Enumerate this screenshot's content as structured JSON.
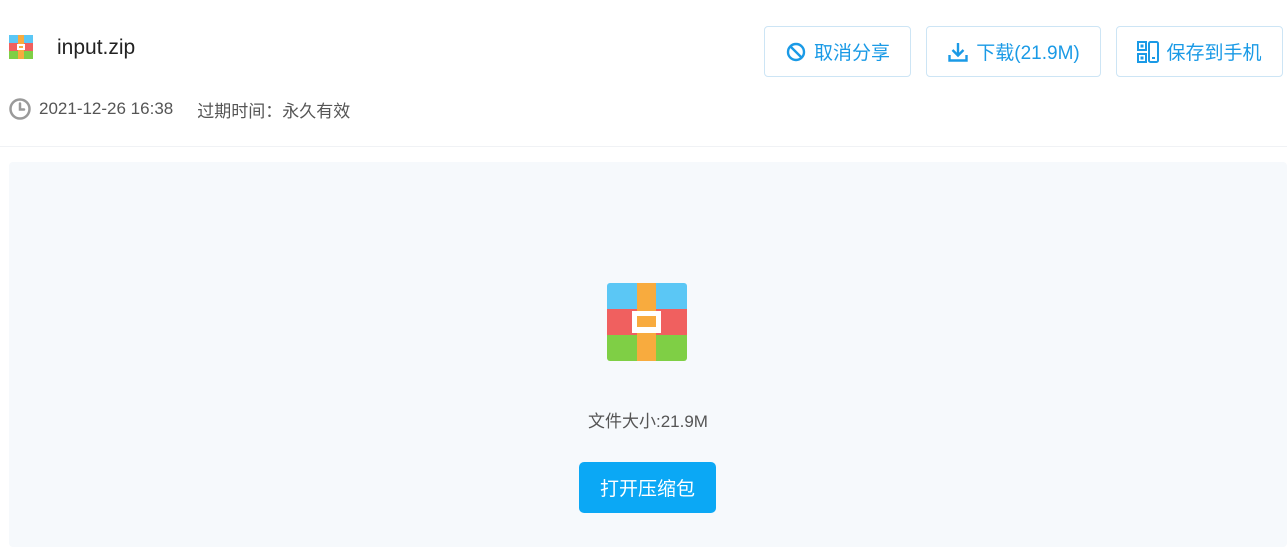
{
  "file": {
    "name": "input.zip",
    "created": "2021-12-26 16:38",
    "expire_label": "过期时间：",
    "expire_value": "永久有效"
  },
  "actions": {
    "cancel_share": "取消分享",
    "download": "下载(21.9M)",
    "save_to_phone": "保存到手机"
  },
  "main": {
    "size_text": "文件大小:21.9M",
    "open_button": "打开压缩包"
  },
  "colors": {
    "accent": "#1a9ae6",
    "primary_button": "#0ba8f5",
    "zip_blue": "#5bc7f5",
    "zip_red": "#f0605f",
    "zip_green": "#7fcf45",
    "zip_orange": "#f8ab3e"
  },
  "icons": {
    "file_type": "zip-archive-icon",
    "time": "clock-icon",
    "cancel": "ban-icon",
    "download": "download-icon",
    "save": "qrcode-phone-icon"
  }
}
